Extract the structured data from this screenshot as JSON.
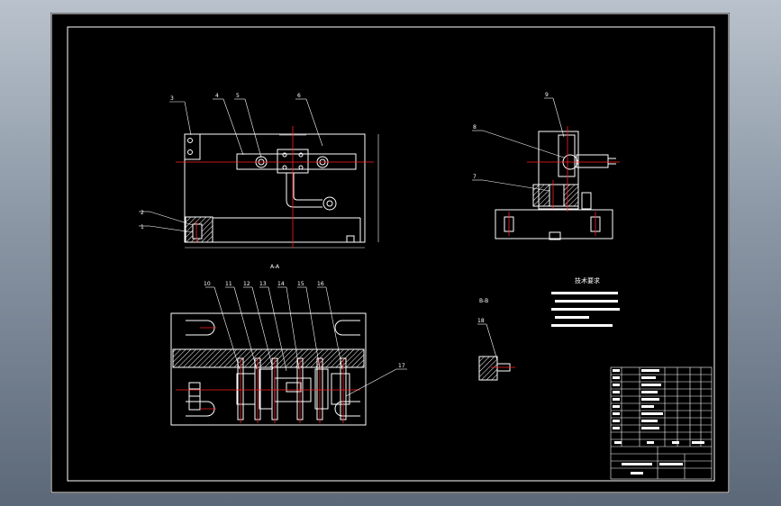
{
  "drawing": {
    "balloons": [
      "1",
      "2",
      "3",
      "4",
      "5",
      "6",
      "7",
      "8",
      "9",
      "10",
      "11",
      "12",
      "13",
      "14",
      "15",
      "16",
      "17",
      "18"
    ],
    "section_label_aa": "A-A",
    "section_label_bb": "B-B",
    "notes_title": "技术要求",
    "colors": {
      "background": "#000000",
      "outline": "#ffffff",
      "centerline": "#ff2020",
      "hatch": "#ffffff",
      "border": "#ffffff"
    }
  }
}
